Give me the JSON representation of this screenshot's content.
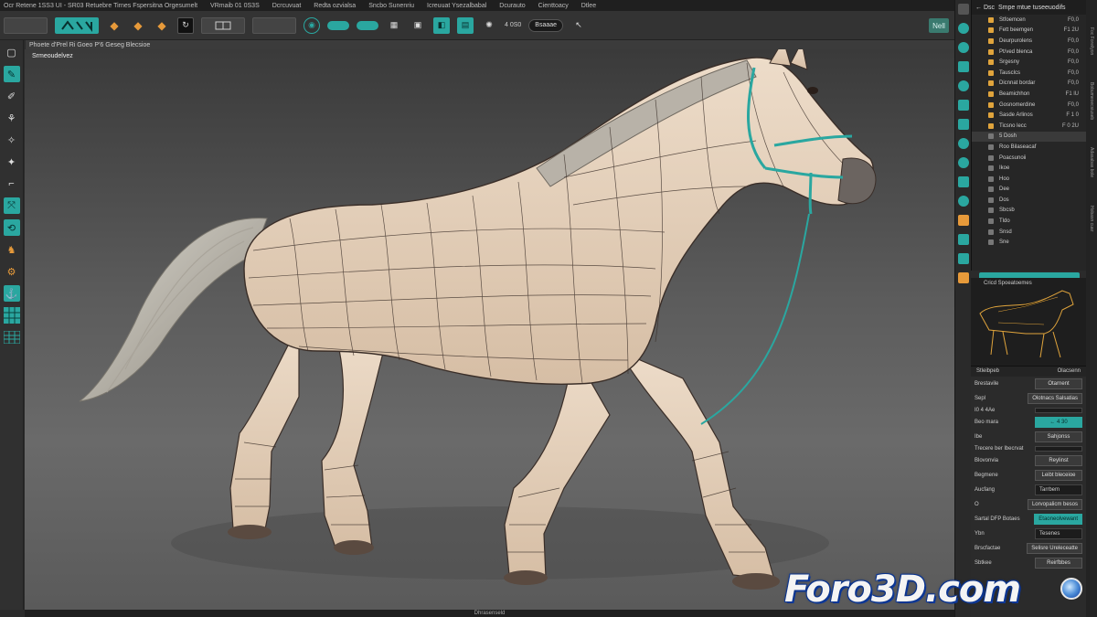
{
  "menubar": {
    "items": [
      "Ocr Retene 1SS3 UI - SR03 Retuebre Tirnes Fspersitna Orgesumelt",
      "VRmaib 01 0S3S",
      "Dcrcuvuat",
      "Redta ozvialsa",
      "Sncbo Sunenriu",
      "Icreuuat Ysezalbabal",
      "Dcurauto",
      "Cienttoacy",
      "Dtlee"
    ]
  },
  "toolbar": {
    "brush_field": "4 0S0",
    "sample_field": "Bsaaae",
    "mode_label": "Nell"
  },
  "subbar": {
    "label": "Phoete d'Prel Ri Goeo P'6 Geseg Blecsioe"
  },
  "viewport": {
    "label": "Srmeoudelvez",
    "status": "Dhrasenseld"
  },
  "outliner": {
    "header_title": "Smpe mtue tuseeuodifs",
    "header_prefix": "← Dsc",
    "rows": [
      {
        "label": "Stfoemcen",
        "value": "F0,0"
      },
      {
        "label": "Fett beemgen",
        "value": "F1 2U"
      },
      {
        "label": "Deurpurolens",
        "value": "F0,0"
      },
      {
        "label": "Pt/ved blenca",
        "value": "F0,0"
      },
      {
        "label": "Srgesny",
        "value": "F0,0"
      },
      {
        "label": "Tausclcs",
        "value": "F0,0"
      },
      {
        "label": "Dicnnat bordar",
        "value": "F0,0"
      },
      {
        "label": "Beamichhon",
        "value": "F1 lU"
      },
      {
        "label": "Gosnomerdine",
        "value": "F0,0"
      },
      {
        "label": "Sasde Arlinos",
        "value": "F 1 0"
      },
      {
        "label": "Ticsno lecc",
        "value": "F 0 2U"
      },
      {
        "label": "5 Dosh",
        "value": ""
      },
      {
        "label": "Roo Bilaseacaf",
        "value": ""
      },
      {
        "label": "Poacsunoii",
        "value": ""
      },
      {
        "label": "Ikoe",
        "value": ""
      },
      {
        "label": "Hoo",
        "value": ""
      },
      {
        "label": "Dee",
        "value": ""
      },
      {
        "label": "Dos",
        "value": ""
      },
      {
        "label": "Sbcsb",
        "value": ""
      },
      {
        "label": "Tldo",
        "value": ""
      },
      {
        "label": "Snsd",
        "value": ""
      },
      {
        "label": "Sne",
        "value": ""
      }
    ]
  },
  "preview": {
    "label": "Cricd Spoeatoemes"
  },
  "properties": {
    "head_left": "Stleibpeb",
    "head_right": "Olacsenn",
    "rows": [
      {
        "label": "Brestavile",
        "value": "Otarnent"
      },
      {
        "label": "Sepl",
        "value": "Olotnacs Salsatias"
      },
      {
        "label": "I0 4 4Ae",
        "value": ""
      },
      {
        "label": "Beo mara",
        "value": "← 4 30"
      },
      {
        "label": "Ibe",
        "value": "Sahjonss"
      },
      {
        "label": "Trecere ber lbecrvat",
        "value": ""
      },
      {
        "label": "Blovonvia",
        "value": "Reylinst"
      },
      {
        "label": "Begmene",
        "value": "Leibt bleceioe"
      },
      {
        "label": "Aucfang",
        "value": "Tarrbem"
      },
      {
        "label": "O",
        "value": "Lorvopalicm besos"
      },
      {
        "label": "Sartal DFP Botaes",
        "value": "Etaoneolvewant"
      },
      {
        "label": "Ybn",
        "value": "Tesenes"
      },
      {
        "label": "Brscfactae",
        "value": "Selisre Ureleceatte"
      },
      {
        "label": "Sbtkee",
        "value": "Reirfbbes"
      }
    ]
  },
  "rightedge": {
    "labels": [
      "Foc Foreilyon",
      "Bobumeoecsiuseb",
      "Adasabas bole",
      "Hobasn cuar"
    ]
  },
  "watermark": {
    "text": "Foro3D.com"
  },
  "colors": {
    "accent": "#2aa7a0",
    "highlight": "#e79a3a",
    "mesh_fill": "#e6d2bf",
    "wire": "#3a2e28"
  }
}
